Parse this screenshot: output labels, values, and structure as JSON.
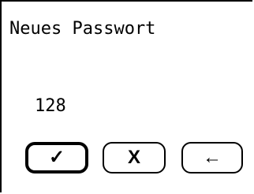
{
  "screen": {
    "title": "Neues Passwort",
    "value": "128"
  },
  "buttons": {
    "confirm_glyph": "✓",
    "cancel_label": "X",
    "back_glyph": "←",
    "confirm_icon": "checkmark-icon",
    "back_icon": "arrow-left-icon"
  }
}
